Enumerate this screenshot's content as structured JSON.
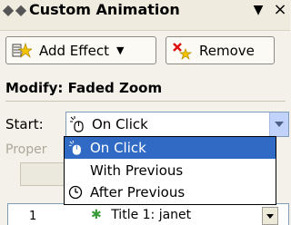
{
  "pane": {
    "title": "Custom Animation"
  },
  "toolbar": {
    "add_effect_label": "Add Effect",
    "remove_label": "Remove"
  },
  "modify": {
    "heading": "Modify: Faded Zoom",
    "start_label": "Start:",
    "start_value": "On Click",
    "property_label": "Proper"
  },
  "start_options": [
    {
      "label": "On Click",
      "icon": "mouse-click-icon",
      "selected": true
    },
    {
      "label": "With Previous",
      "icon": "",
      "selected": false
    },
    {
      "label": "After Previous",
      "icon": "clock-icon",
      "selected": false
    }
  ],
  "animation_list": {
    "row_number": "1",
    "row_text": "Title 1: janet"
  },
  "colors": {
    "selection": "#316ac5",
    "combo_button": "#c1d3fb"
  }
}
